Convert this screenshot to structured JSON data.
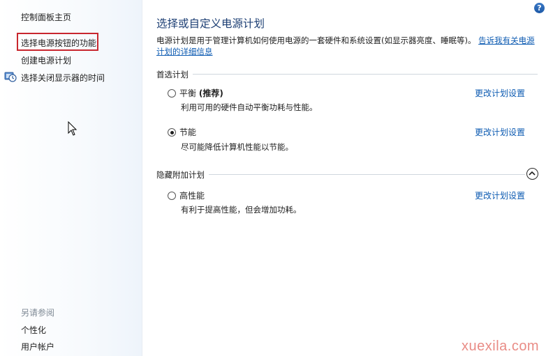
{
  "sidebar": {
    "home": "控制面板主页",
    "items": [
      {
        "label": "选择电源按钮的功能"
      },
      {
        "label": "创建电源计划"
      },
      {
        "label": "选择关闭显示器的时间"
      }
    ],
    "see_also_title": "另请参阅",
    "see_also": [
      {
        "label": "个性化"
      },
      {
        "label": "用户帐户"
      }
    ]
  },
  "main": {
    "title": "选择或自定义电源计划",
    "description": "电源计划是用于管理计算机如何使用电源的一套硬件和系统设置(如显示器亮度、睡眠等)。",
    "description_link": "告诉我有关电源计划的详细信息",
    "preferred_section": "首选计划",
    "hidden_section": "隐藏附加计划",
    "plans": [
      {
        "name": "平衡",
        "tag": "(推荐)",
        "desc": "利用可用的硬件自动平衡功耗与性能。",
        "selected": false,
        "link": "更改计划设置"
      },
      {
        "name": "节能",
        "tag": "",
        "desc": "尽可能降低计算机性能以节能。",
        "selected": true,
        "link": "更改计划设置"
      },
      {
        "name": "高性能",
        "tag": "",
        "desc": "有利于提高性能，但会增加功耗。",
        "selected": false,
        "link": "更改计划设置"
      }
    ]
  },
  "help": "?",
  "watermark": "xuexila.com",
  "colors": {
    "title": "#1d3f74",
    "link": "#0d5bb2",
    "highlight_border": "#c8262e"
  }
}
